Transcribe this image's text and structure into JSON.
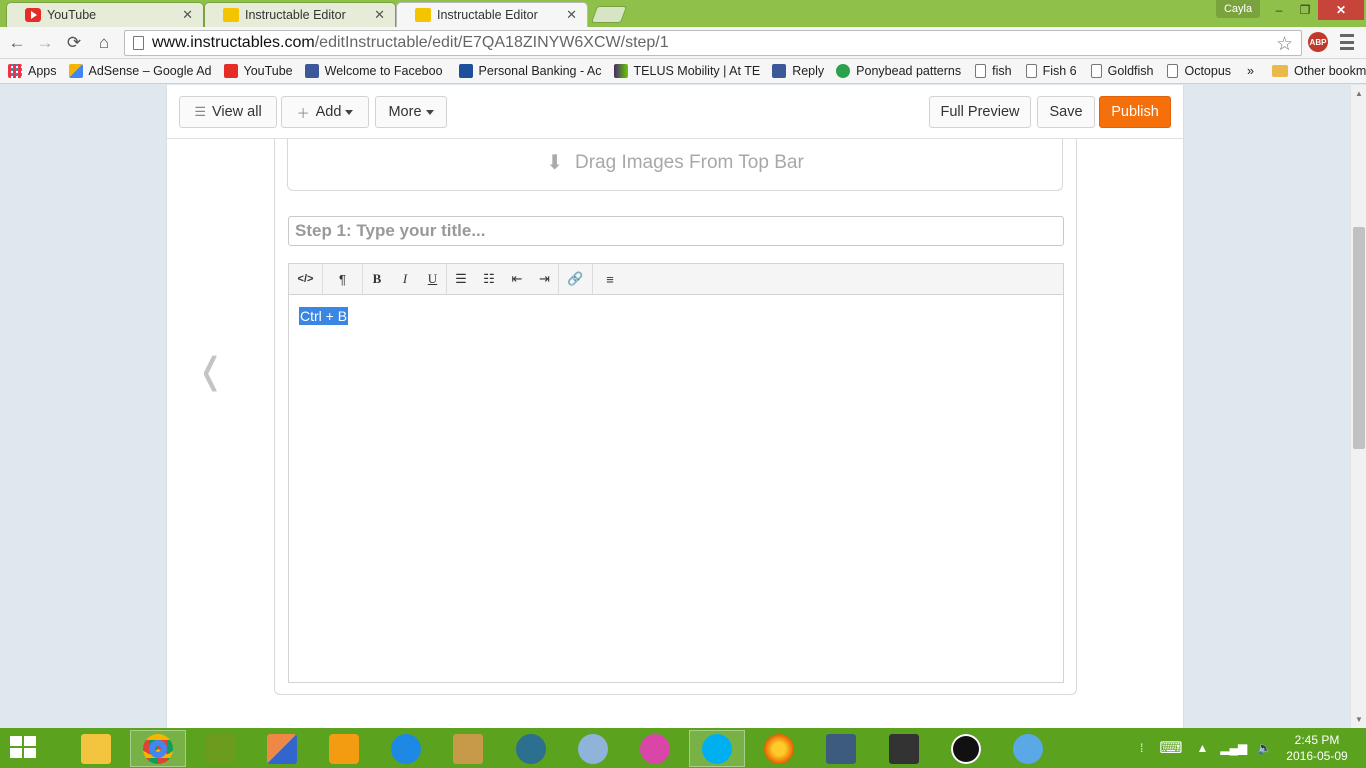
{
  "browser": {
    "tabs": [
      {
        "label": "YouTube",
        "icon": "youtube-icon",
        "active": false
      },
      {
        "label": "Instructable Editor",
        "icon": "instructables-icon",
        "active": false
      },
      {
        "label": "Instructable Editor",
        "icon": "instructables-icon",
        "active": true
      }
    ],
    "user": "Cayla",
    "window_controls": {
      "minimize": "–",
      "restore": "❐",
      "close": "✕"
    },
    "url_host": "www.instructables.com",
    "url_path": "/editInstructable/edit/E7QA18ZINYW6XCW/step/1",
    "abp_label": "ABP"
  },
  "bookmarks": [
    {
      "label": "Apps",
      "icon": "apps-grid-icon"
    },
    {
      "label": "AdSense – Google Ad",
      "icon": "adsense-icon"
    },
    {
      "label": "YouTube",
      "icon": "youtube-icon"
    },
    {
      "label": "Welcome to Faceboo",
      "icon": "facebook-icon"
    },
    {
      "label": "Personal Banking - Ac",
      "icon": "bank-icon"
    },
    {
      "label": "TELUS Mobility | At TE",
      "icon": "telus-icon"
    },
    {
      "label": "Reply",
      "icon": "facebook-icon"
    },
    {
      "label": "Ponybead patterns",
      "icon": "ponybead-icon"
    },
    {
      "label": "fish",
      "icon": "page-icon"
    },
    {
      "label": "Fish 6",
      "icon": "page-icon"
    },
    {
      "label": "Goldfish",
      "icon": "page-icon"
    },
    {
      "label": "Octopus",
      "icon": "page-icon"
    }
  ],
  "bookmarks_more": "»",
  "bookmarks_other": "Other bookmarks",
  "editor": {
    "view_all": "View all",
    "add": "Add",
    "more": "More",
    "full_preview": "Full Preview",
    "save": "Save",
    "publish": "Publish",
    "publish_color": "#f56f0b",
    "drag_images": "Drag Images From Top Bar",
    "step_title_placeholder": "Step 1:  Type your title...",
    "toolbar": {
      "html": "</>",
      "paragraph": "¶",
      "bold": "B",
      "italic": "I",
      "underline": "U"
    },
    "body_selected_text": "Ctrl + B",
    "selection_color": "#3a86e3"
  },
  "taskbar": {
    "color": "#5ba21f",
    "time": "2:45 PM",
    "date": "2016-05-09"
  }
}
